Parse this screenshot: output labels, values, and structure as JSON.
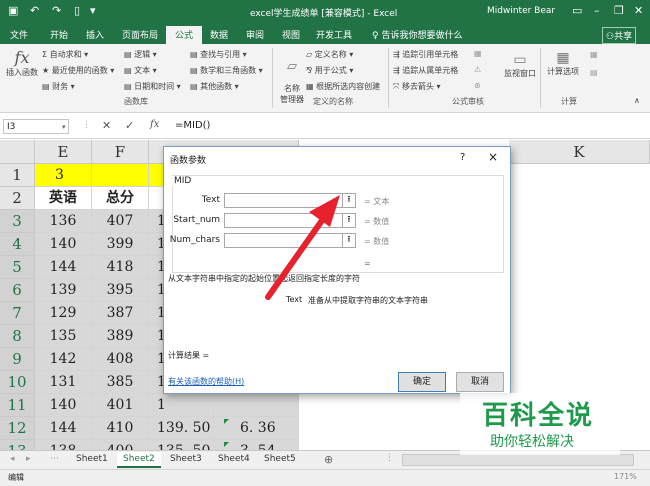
{
  "titlebar": {
    "title": "excel学生成绩单 [兼容模式] - Excel",
    "user": "Midwinter Bear",
    "qa_icons": [
      "save-icon",
      "undo-icon",
      "redo-icon",
      "file-icon",
      "customize-icon"
    ],
    "window_controls": [
      "ribbon-display-icon",
      "minimize-icon",
      "restore-icon",
      "close-icon"
    ]
  },
  "tabs": [
    "文件",
    "开始",
    "插入",
    "页面布局",
    "公式",
    "数据",
    "审阅",
    "视图",
    "开发工具"
  ],
  "active_tab": "公式",
  "tellme": "告诉我你想要做什么",
  "share": "共享",
  "ribbon": {
    "insert_function": "插入函数",
    "autosum": "自动求和",
    "recent": "最近使用的函数",
    "finance": "财务",
    "logical": "逻辑",
    "text": "文本",
    "datetime": "日期和时间",
    "lookup": "查找与引用",
    "math": "数学和三角函数",
    "other": "其他函数",
    "group_library": "函数库",
    "name_manager": "名称\n管理器",
    "define_name": "定义名称",
    "use_in_formula": "用于公式",
    "create_from_sel": "根据所选内容创建",
    "group_names": "定义的名称",
    "trace_prec": "追踪引用单元格",
    "trace_dep": "追踪从属单元格",
    "remove_arrows": "移去箭头",
    "group_audit": "公式审核",
    "watch": "监视窗口",
    "calc_options": "计算选项",
    "group_calc": "计算"
  },
  "formula_bar": {
    "name_box": "I3",
    "content": "=MID()",
    "icons": [
      "cancel-icon",
      "enter-icon",
      "fx-icon"
    ]
  },
  "columns": [
    "E",
    "F",
    "K"
  ],
  "rows": [
    "1",
    "2",
    "3",
    "4",
    "5",
    "6",
    "7",
    "8",
    "9",
    "10",
    "11",
    "12",
    "13"
  ],
  "cells": {
    "E1": "3",
    "E2": "英语",
    "F2": "总分",
    "E": [
      "136",
      "140",
      "144",
      "139",
      "129",
      "135",
      "142",
      "131",
      "140",
      "144",
      "138"
    ],
    "F": [
      "407",
      "399",
      "418",
      "395",
      "387",
      "389",
      "408",
      "385",
      "401",
      "410",
      "400"
    ],
    "G_visible": [
      "1",
      "1",
      "1",
      "1",
      "1",
      "1",
      "1",
      "1",
      "1",
      "139. 50",
      "135. 50"
    ],
    "H_visible": [
      "6. 36",
      "3. 54"
    ]
  },
  "dialog": {
    "title": "函数参数",
    "help_q": "?",
    "close": "×",
    "function_name": "MID",
    "args": [
      {
        "label": "Text",
        "type": "= 文本"
      },
      {
        "label": "Start_num",
        "type": "= 数值"
      },
      {
        "label": "Num_chars",
        "type": "= 数值"
      }
    ],
    "equals": "=",
    "description": "从文本字符串中指定的起始位置起返回指定长度的字符",
    "arg_help_name": "Text",
    "arg_help": "准备从中提取字符串的文本字符串",
    "result": "计算结果 =",
    "help_link": "有关该函数的帮助(H)",
    "ok": "确定",
    "cancel": "取消"
  },
  "sheets": [
    "Sheet1",
    "Sheet2",
    "Sheet3",
    "Sheet4",
    "Sheet5"
  ],
  "active_sheet": "Sheet2",
  "status": {
    "mode": "编辑",
    "zoom": "171%"
  },
  "watermark": {
    "line1": "百科全说",
    "line2": "助你轻松解决"
  },
  "colors": {
    "excel_green": "#217346",
    "arrow_red": "#e8212e",
    "cell_yellow": "#ffff00"
  }
}
